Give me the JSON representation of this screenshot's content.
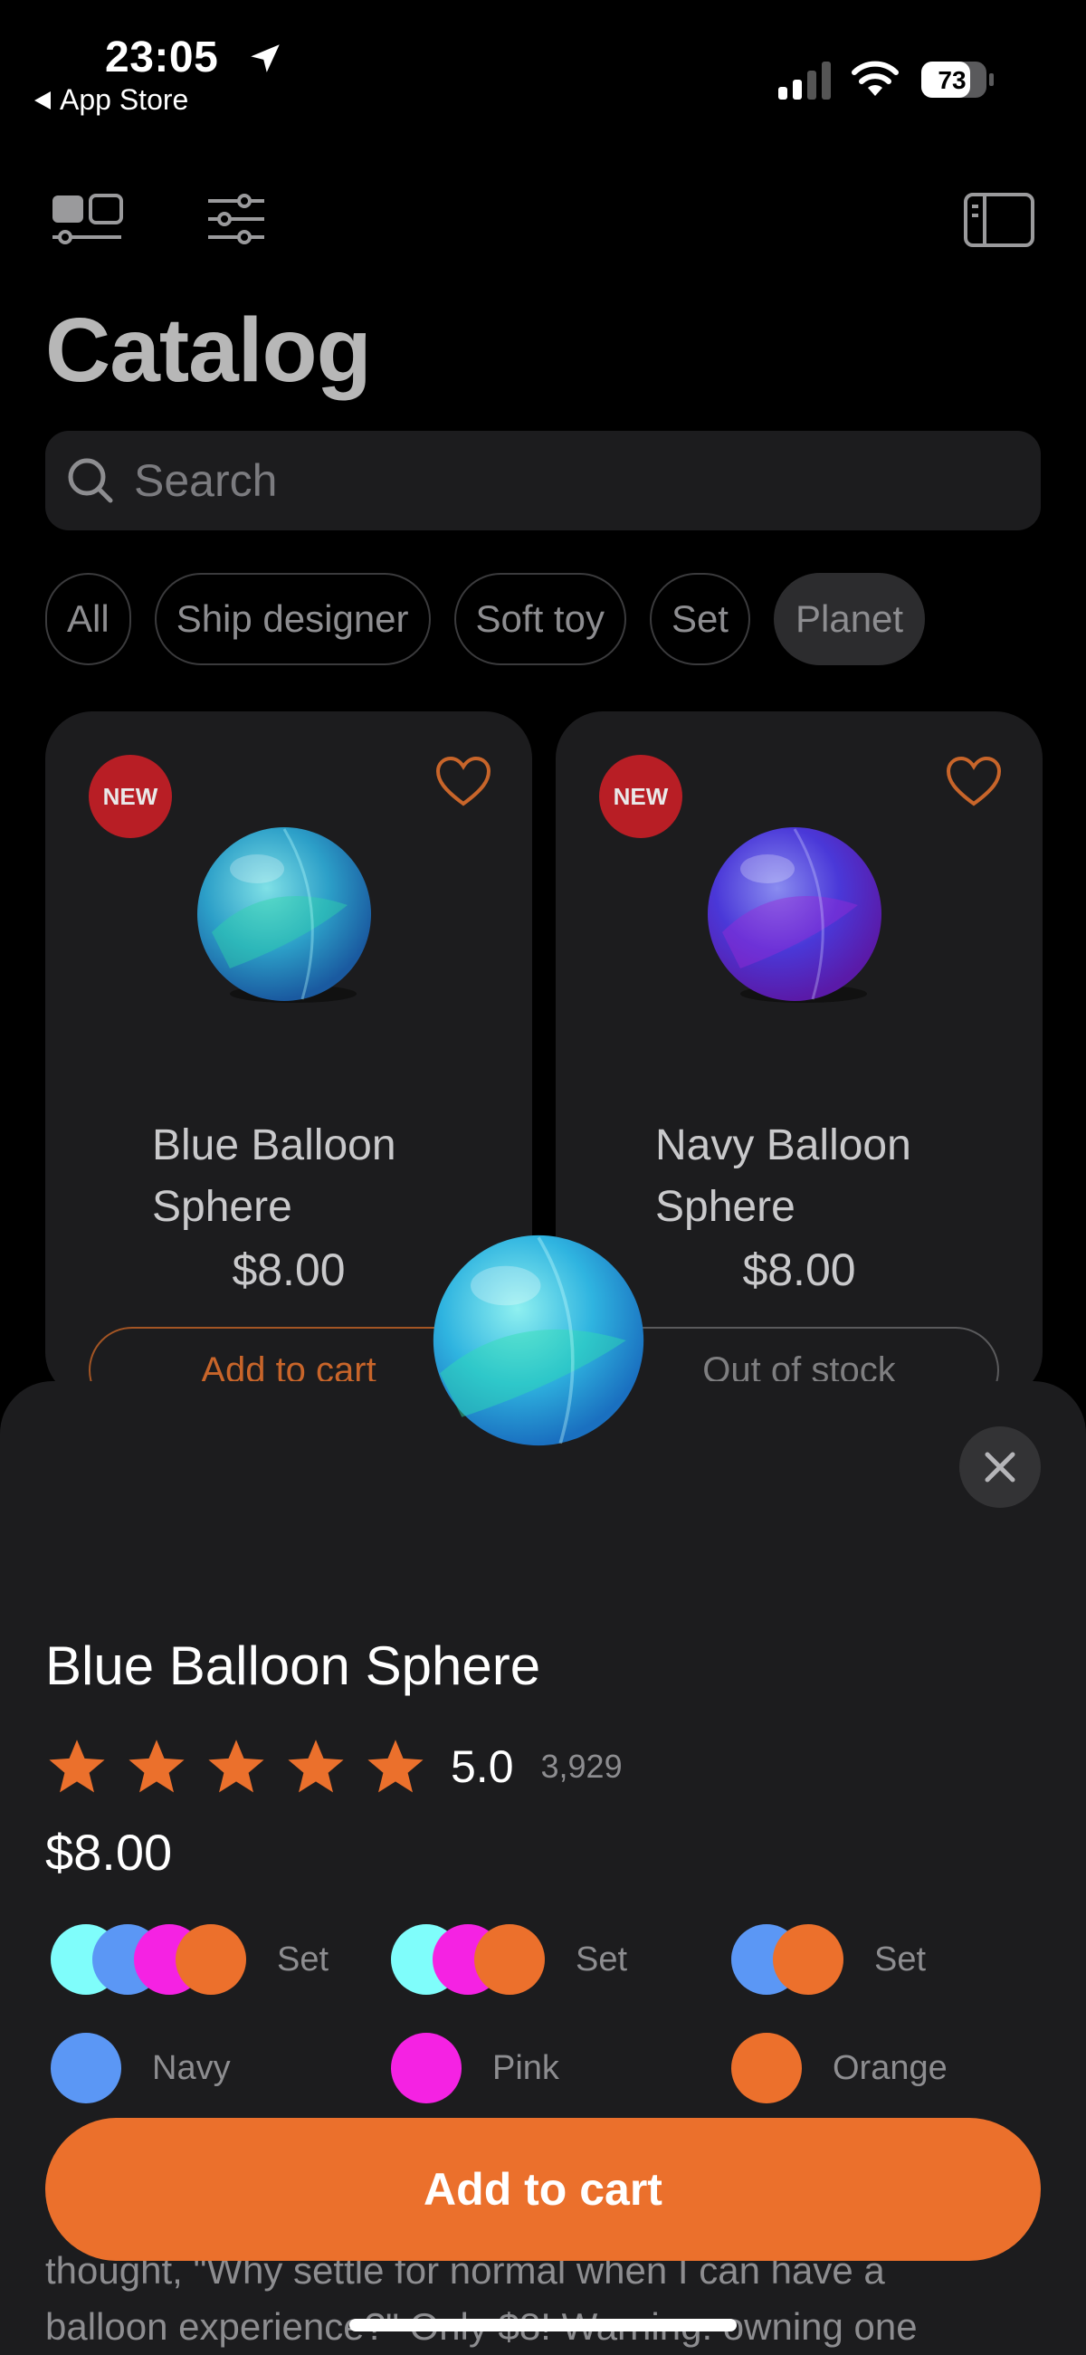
{
  "status": {
    "time": "23:05",
    "back_app": "App Store",
    "battery": "73"
  },
  "title": "Catalog",
  "search": {
    "placeholder": "Search"
  },
  "chips": [
    {
      "label": "All",
      "active": false
    },
    {
      "label": "Ship designer",
      "active": false
    },
    {
      "label": "Soft toy",
      "active": false
    },
    {
      "label": "Set",
      "active": false
    },
    {
      "label": "Planet",
      "active": true
    }
  ],
  "cards": [
    {
      "badge": "NEW",
      "name": "Blue Balloon Sphere",
      "price": "$8.00",
      "button": "Add to cart",
      "ball_color": "blue"
    },
    {
      "badge": "NEW",
      "name": "Navy Balloon Sphere",
      "price": "$8.00",
      "button": "Out of stock",
      "ball_color": "purple"
    }
  ],
  "sheet": {
    "title": "Blue Balloon Sphere",
    "rating": "5.0",
    "stars": 5,
    "rating_count": "3,929",
    "price": "$8.00",
    "variants": [
      {
        "label": "Set",
        "colors": [
          "#7ffdfb",
          "#5b97f5",
          "#f522e3",
          "#ec702c"
        ]
      },
      {
        "label": "Set",
        "colors": [
          "#7ffdfb",
          "#f522e3",
          "#ec702c"
        ]
      },
      {
        "label": "Set",
        "colors": [
          "#5b97f5",
          "#ec702c"
        ]
      },
      {
        "label": "Navy",
        "colors": [
          "#5b97f5"
        ]
      },
      {
        "label": "Pink",
        "colors": [
          "#f522e3"
        ]
      },
      {
        "label": "Orange",
        "colors": [
          "#ec702c"
        ]
      }
    ],
    "description_lines": [
      "thought, \"Why settle for normal when I can have a",
      "balloon experience?\" Only $8! Warning: owning one"
    ],
    "cta": "Add to cart"
  },
  "colors": {
    "accent": "#eb702c",
    "badge": "#b81e25",
    "surface": "#1c1c1e",
    "background": "#000000"
  },
  "icons": [
    "location-arrow-icon",
    "signal-icon",
    "wifi-icon",
    "battery-icon",
    "grid-view-icon",
    "filter-icon",
    "sidebar-icon",
    "search-icon",
    "heart-icon",
    "close-icon",
    "star-icon"
  ]
}
